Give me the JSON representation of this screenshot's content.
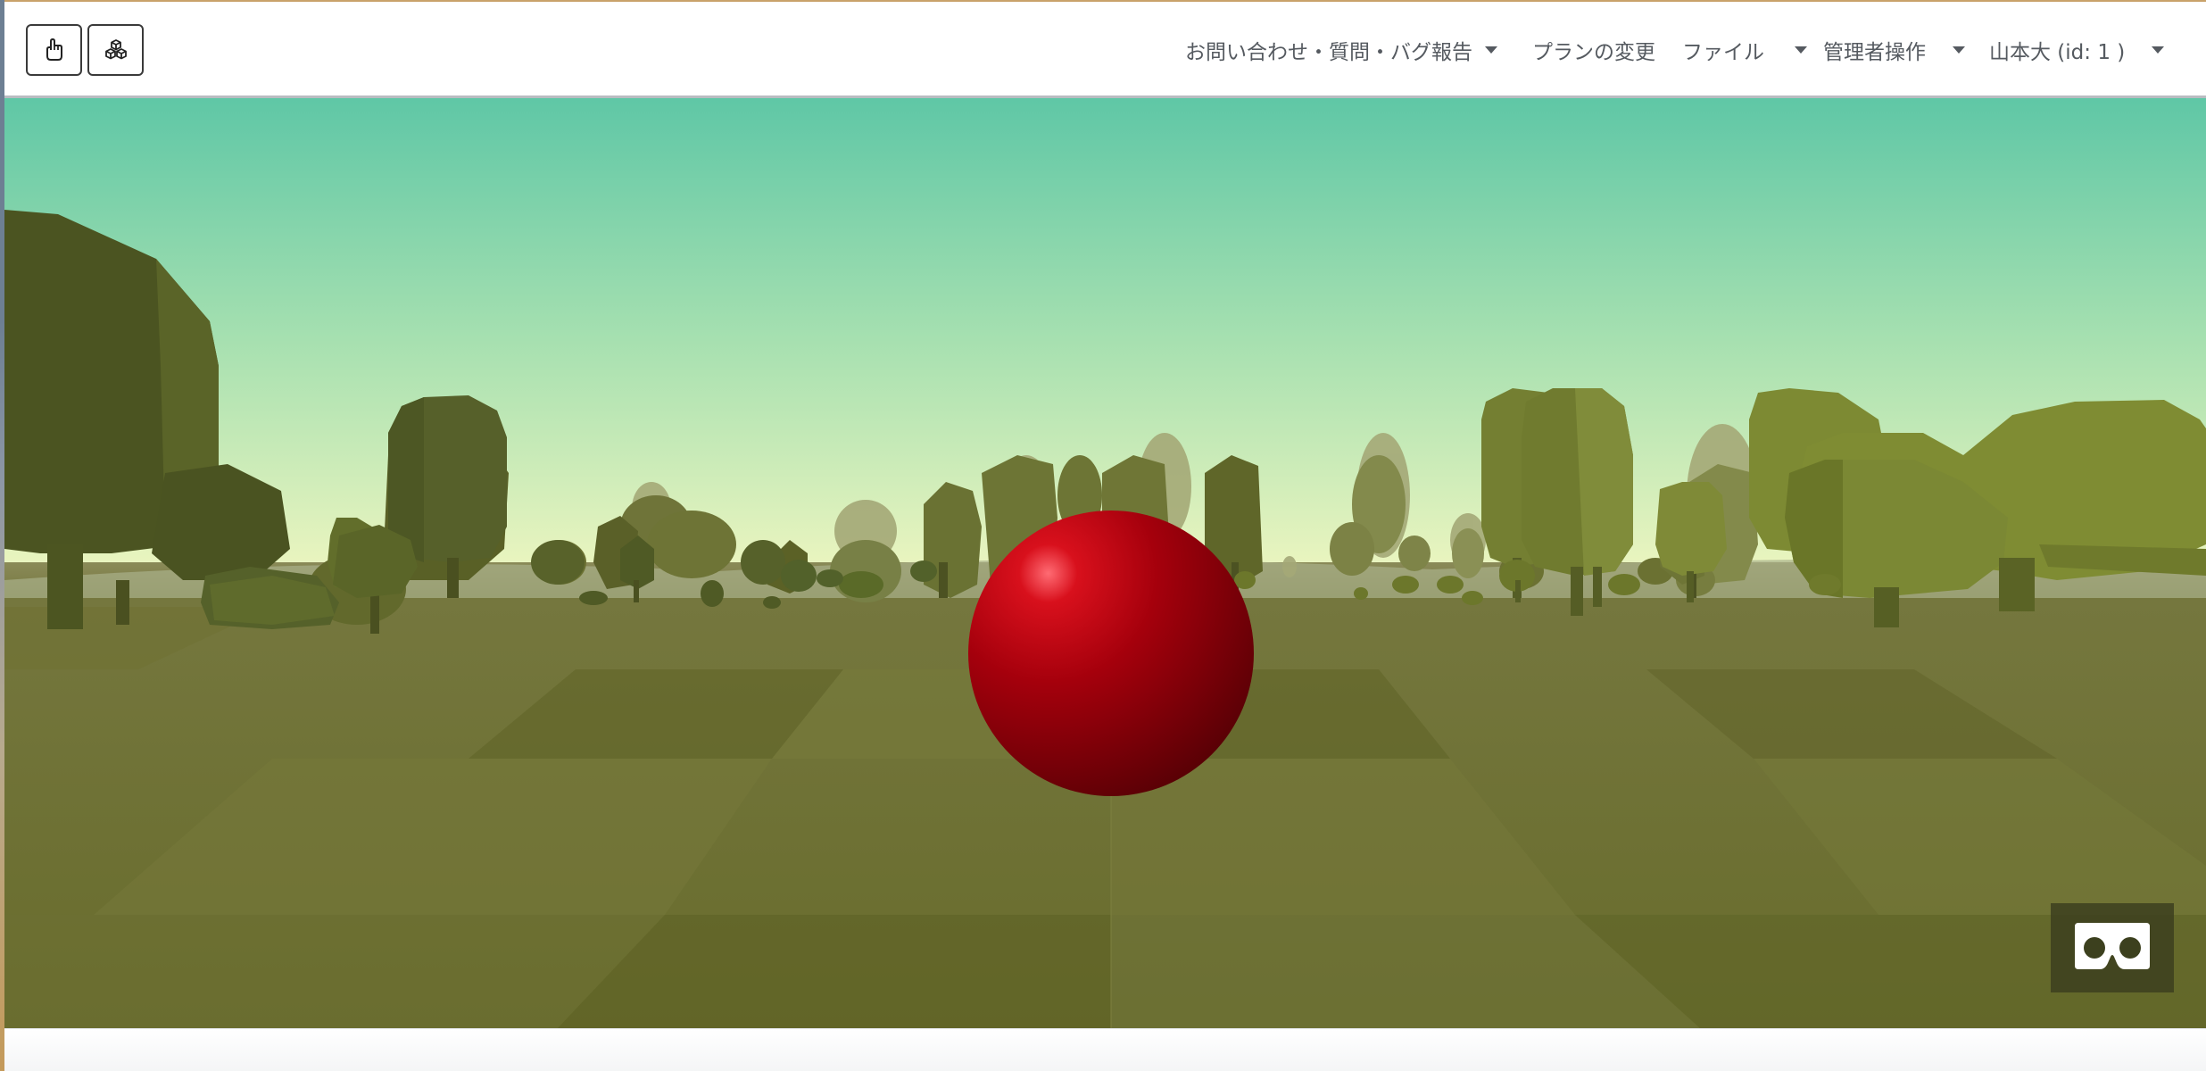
{
  "toolbar": {
    "hand_tool_icon": "hand-pointer-icon",
    "blocks_tool_icon": "cubes-icon"
  },
  "menu": {
    "contact": "お問い合わせ・質問・バグ報告",
    "plan": "プランの変更",
    "file": "ファイル",
    "admin": "管理者操作",
    "user": "山本大 (id: 1 )"
  },
  "scene": {
    "sky_top_color": "#5fc7a6",
    "sky_horizon_color": "#e9f5bf",
    "ground_color": "#6b7030",
    "ball_color": "#b4000b",
    "vr_button_icon": "vr-headset-icon"
  }
}
